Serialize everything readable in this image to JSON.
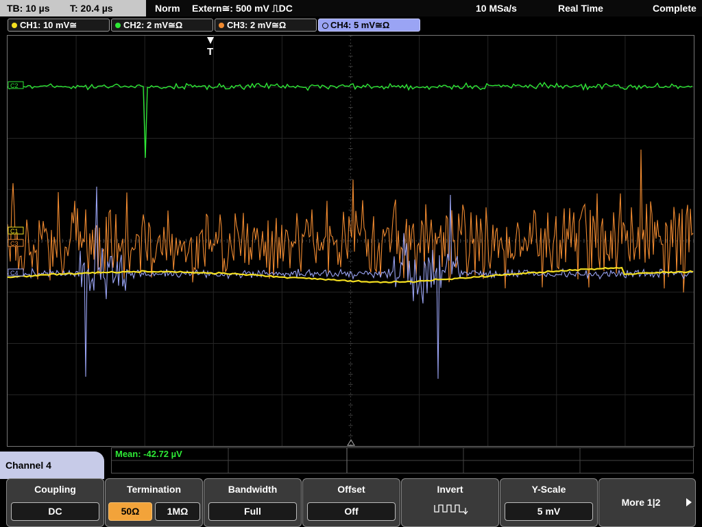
{
  "status_bar": {
    "timebase": "TB: 10 µs",
    "trigger_time": "T: 20.4 µs",
    "acq_mode": "Norm",
    "trigger_source": "Extern≅: 500 mV ⎍DC",
    "sample_rate": "10 MSa/s",
    "mode": "Real Time",
    "state": "Complete"
  },
  "channels": [
    {
      "label": "CH1: 10 mV≅",
      "color": "#f5e020"
    },
    {
      "label": "CH2: 2 mV≅Ω",
      "color": "#2ee836"
    },
    {
      "label": "CH3: 2 mV≅Ω",
      "color": "#f08a30"
    },
    {
      "label": "CH4: 5 mV≅Ω",
      "color": "#9aa4f4"
    }
  ],
  "trigger_marker": "T",
  "ref_markers": {
    "ch2": "C2",
    "ch1": "C1",
    "ch3": "C3",
    "ch4": "C4"
  },
  "measurement": "Mean: -42.72 µV",
  "channel_panel": "Channel 4",
  "softkeys": {
    "coupling": {
      "title": "Coupling",
      "value": "DC"
    },
    "termination": {
      "title": "Termination",
      "opt1": "50Ω",
      "opt2": "1MΩ"
    },
    "bandwidth": {
      "title": "Bandwidth",
      "value": "Full"
    },
    "offset": {
      "title": "Offset",
      "value": "Off"
    },
    "invert": {
      "title": "Invert"
    },
    "yscale": {
      "title": "Y-Scale",
      "value": "5 mV"
    },
    "more": {
      "title": "More 1|2"
    }
  }
}
